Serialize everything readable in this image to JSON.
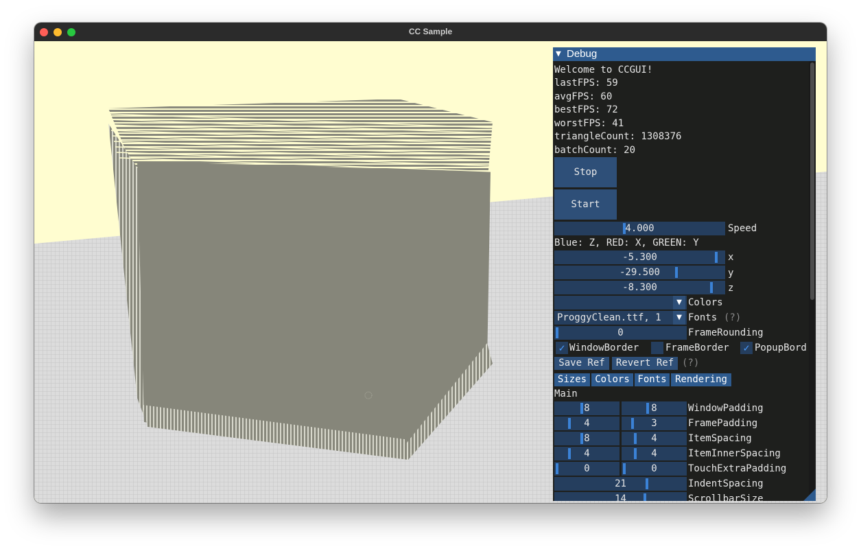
{
  "window": {
    "title": "CC Sample"
  },
  "debug": {
    "title": "Debug",
    "stats": {
      "welcome": "Welcome to CCGUI!",
      "last_fps": "lastFPS: 59",
      "avg_fps": "avgFPS: 60",
      "best_fps": "bestFPS: 72",
      "worst_fps": "worstFPS: 41",
      "triangle_count": "triangleCount: 1308376",
      "batch_count": "batchCount: 20"
    },
    "stop_label": "Stop",
    "start_label": "Start",
    "speed": {
      "value": "4.000",
      "label": "Speed"
    },
    "axis_note": "Blue: Z, RED: X, GREEN: Y",
    "x": {
      "value": "-5.300",
      "label": "x"
    },
    "y": {
      "value": "-29.500",
      "label": "y"
    },
    "z": {
      "value": "-8.300",
      "label": "z"
    },
    "colors_combo": {
      "value": "",
      "label": "Colors"
    },
    "fonts_combo": {
      "value": "ProggyClean.ttf, 1",
      "label": "Fonts",
      "help": "(?)"
    },
    "frame_rounding": {
      "value": "0",
      "label": "FrameRounding"
    },
    "window_border": {
      "label": "WindowBorder",
      "checked": true
    },
    "frame_border": {
      "label": "FrameBorder",
      "checked": false
    },
    "popup_border": {
      "label": "PopupBord",
      "checked": true
    },
    "save_ref": "Save Ref",
    "revert_ref": "Revert Ref",
    "ref_help": "(?)",
    "tabs": [
      "Sizes",
      "Colors",
      "Fonts",
      "Rendering"
    ],
    "section_main": "Main",
    "sizes": [
      {
        "a": "8",
        "b": "8",
        "label": "WindowPadding"
      },
      {
        "a": "4",
        "b": "3",
        "label": "FramePadding"
      },
      {
        "a": "8",
        "b": "4",
        "label": "ItemSpacing"
      },
      {
        "a": "4",
        "b": "4",
        "label": "ItemInnerSpacing"
      },
      {
        "a": "0",
        "b": "0",
        "label": "TouchExtraPadding"
      }
    ],
    "indent_spacing": {
      "value": "21",
      "label": "IndentSpacing"
    },
    "scrollbar_size": {
      "value": "14",
      "label": "ScrollbarSize"
    }
  },
  "colors": {
    "background": "#fffdd0",
    "cube": "#86867a",
    "accent": "#2e5b8f"
  }
}
